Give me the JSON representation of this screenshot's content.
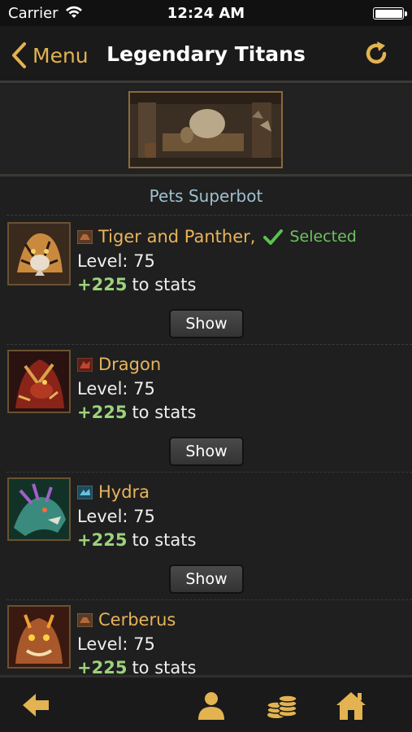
{
  "status_bar": {
    "carrier": "Carrier",
    "time": "12:24 AM"
  },
  "nav": {
    "back_label": "Menu",
    "title": "Legendary Titans"
  },
  "section": {
    "title": "Pets Superbot"
  },
  "pets": [
    {
      "name": "Tiger and Panther",
      "comma": ",",
      "selected_label": "Selected",
      "level": "Level: 75",
      "stats_value": "+225",
      "stats_suffix": "to stats",
      "button_label": "Show"
    },
    {
      "name": "Dragon",
      "level": "Level: 75",
      "stats_value": "+225",
      "stats_suffix": "to stats",
      "button_label": "Show"
    },
    {
      "name": "Hydra",
      "level": "Level: 75",
      "stats_value": "+225",
      "stats_suffix": "to stats",
      "button_label": "Show"
    },
    {
      "name": "Cerberus",
      "level": "Level: 75",
      "stats_value": "+225",
      "stats_suffix": "to stats"
    }
  ],
  "tab_bar": {
    "icons": [
      "back-arrow-icon",
      "person-icon",
      "coins-icon",
      "home-icon"
    ]
  },
  "colors": {
    "accent": "#e2b350",
    "pet_name": "#e8b45a",
    "selected": "#6cc25e",
    "stats": "#9bd27c",
    "section_title": "#9fc0d0"
  }
}
